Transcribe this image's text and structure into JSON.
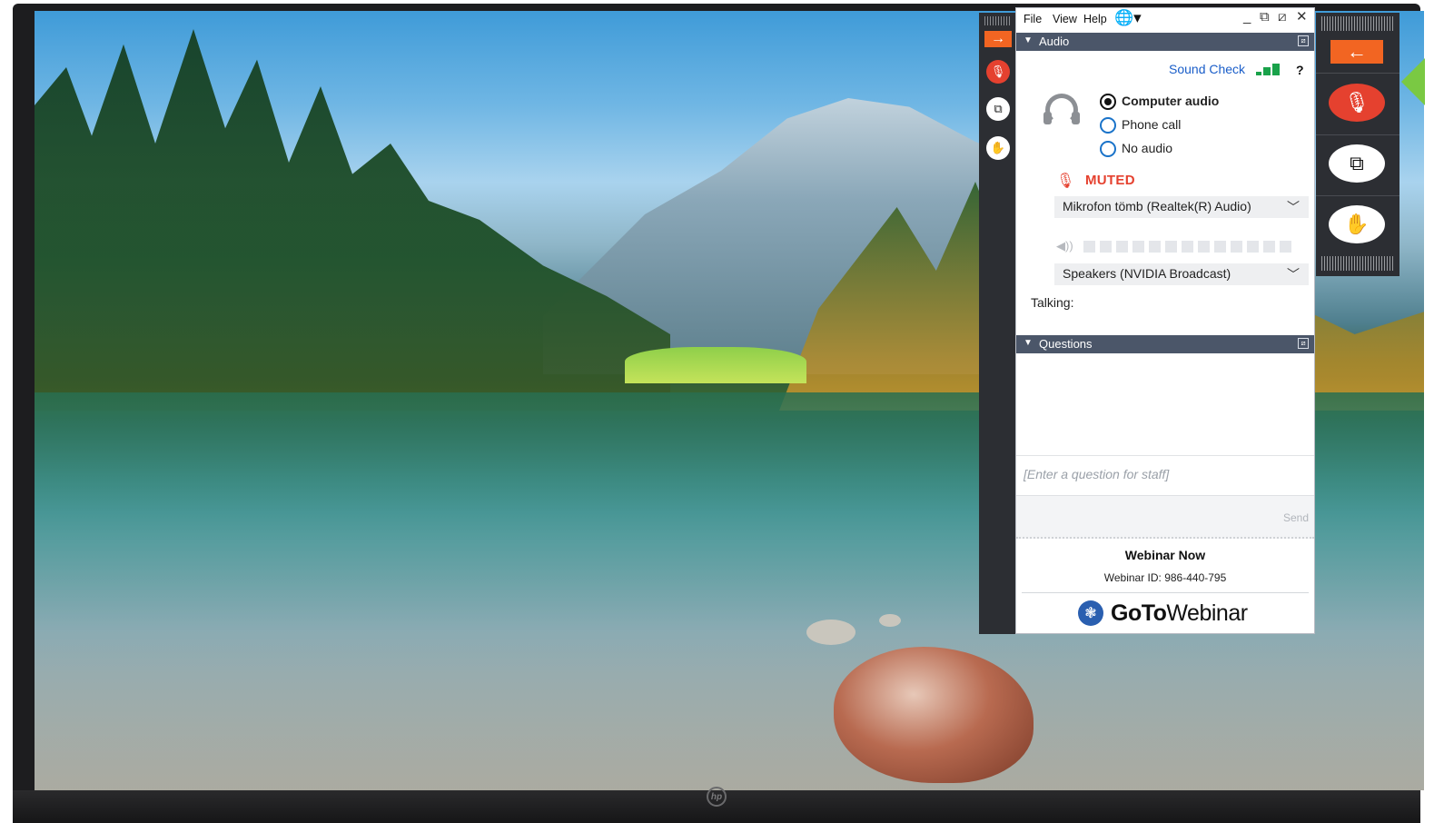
{
  "menu": {
    "file": "File",
    "view": "View",
    "help": "Help",
    "globe_icon": "globe-icon",
    "window_controls": [
      "_",
      "⧉",
      "⧄",
      "✕"
    ]
  },
  "audio": {
    "header": "Audio",
    "sound_check": "Sound Check",
    "help": "?",
    "options": [
      "Computer audio",
      "Phone call",
      "No audio"
    ],
    "selected_option": "Computer audio",
    "status": "MUTED",
    "microphone": "Mikrofon tömb (Realtek(R) Audio)",
    "speakers": "Speakers (NVIDIA Broadcast)",
    "talking_label": "Talking:"
  },
  "questions": {
    "header": "Questions",
    "placeholder": "[Enter a question for staff]",
    "send": "Send"
  },
  "footer": {
    "title": "Webinar Now",
    "webinar_id": "Webinar ID: 986-440-795",
    "brand_bold": "GoTo",
    "brand_regular": "Webinar"
  },
  "colors": {
    "accent_orange": "#f26522",
    "muted_red": "#e5412f",
    "link_blue": "#1a5ec9",
    "section_header": "#4b5669",
    "signal_green": "#19a24a"
  }
}
